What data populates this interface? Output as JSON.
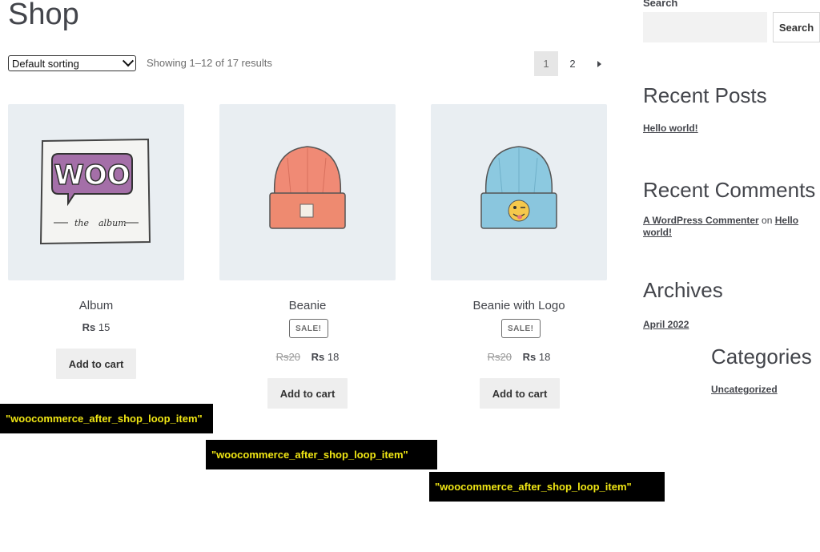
{
  "page": {
    "title": "Shop"
  },
  "toolbar": {
    "sort_selected": "Default sorting",
    "result_count": "Showing 1–12 of 17 results",
    "pages": [
      "1",
      "2"
    ]
  },
  "products": [
    {
      "title": "Album",
      "currency": "Rs",
      "price": "15",
      "button": "Add to cart"
    },
    {
      "title": "Beanie",
      "badge": "SALE!",
      "currency": "Rs",
      "old_price": "20",
      "price": "18",
      "button": "Add to cart"
    },
    {
      "title": "Beanie with Logo",
      "badge": "SALE!",
      "currency": "Rs",
      "old_price": "20",
      "price": "18",
      "button": "Add to cart"
    }
  ],
  "hooks": [
    "\"woocommerce_after_shop_loop_item\"",
    "\"woocommerce_after_shop_loop_item\"",
    "\"woocommerce_after_shop_loop_item\""
  ],
  "sidebar": {
    "search_label": "Search",
    "search_button": "Search",
    "recent_posts_title": "Recent Posts",
    "recent_posts": [
      "Hello world!"
    ],
    "recent_comments_title": "Recent Comments",
    "comment_author": "A WordPress Commenter",
    "comment_on": "on",
    "comment_post": "Hello world!",
    "archives_title": "Archives",
    "archives": [
      "April 2022"
    ],
    "categories_title": "Categories",
    "categories": [
      "Uncategorized"
    ]
  },
  "colors": {
    "hook_bg": "#000000",
    "hook_text": "#f0e614",
    "product_bg": "#e9eef2",
    "button_bg": "#eeeeee"
  }
}
